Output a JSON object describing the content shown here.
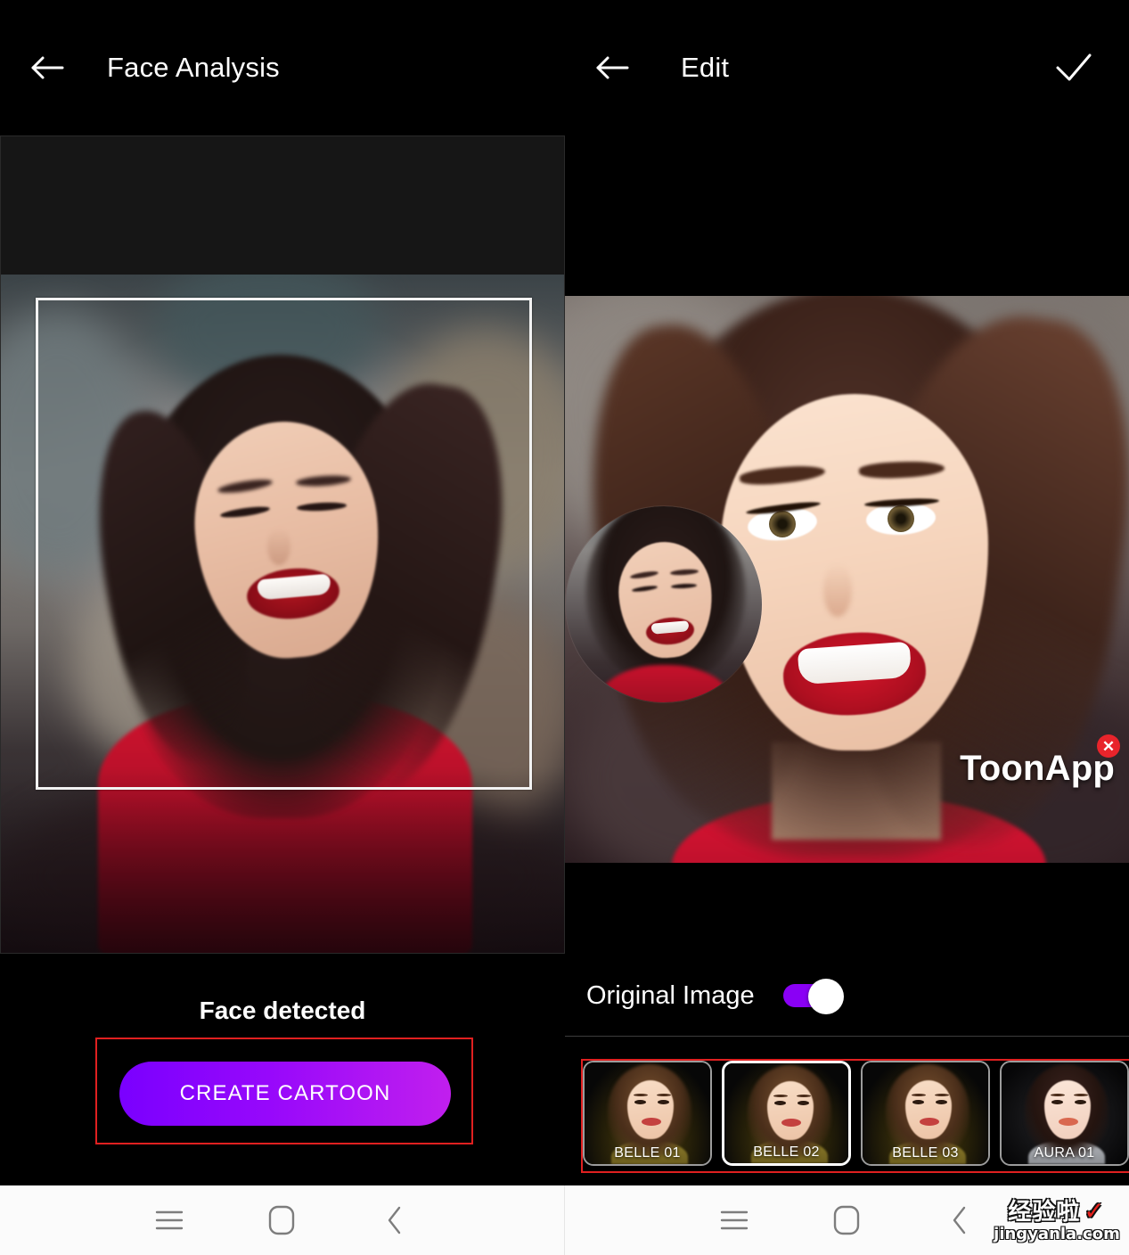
{
  "left_panel": {
    "header": {
      "back_icon": "arrow-left-icon",
      "title": "Face Analysis"
    },
    "stage": {
      "detection_frame": "face-detection-frame",
      "photo_alt": "original-portrait-photo"
    },
    "footer": {
      "status_text": "Face detected",
      "create_button_label": "CREATE CARTOON",
      "annotation_color": "#e02020"
    }
  },
  "right_panel": {
    "header": {
      "back_icon": "arrow-left-icon",
      "title": "Edit",
      "confirm_icon": "check-icon"
    },
    "stage": {
      "cartoon_alt": "cartoon-result-image",
      "original_bubble_alt": "original-image-preview",
      "watermark_text": "ToonApp",
      "watermark_close_label": "✕"
    },
    "controls": {
      "toggle_label": "Original Image",
      "toggle_on": true,
      "toggle_color": "#8a00f5",
      "annotation_color": "#e02020"
    },
    "styles": [
      {
        "label": "BELLE 01",
        "selected": false,
        "theme": "belle"
      },
      {
        "label": "BELLE 02",
        "selected": true,
        "theme": "belle"
      },
      {
        "label": "BELLE 03",
        "selected": false,
        "theme": "belle"
      },
      {
        "label": "AURA 01",
        "selected": false,
        "theme": "aura"
      }
    ]
  },
  "system_nav": {
    "recents_icon": "menu-icon",
    "home_icon": "home-square-icon",
    "back_icon": "chevron-left-icon"
  },
  "site_watermark": {
    "brand_cn": "经验啦",
    "tick": "✓",
    "url": "jingyanla.com"
  },
  "accent": {
    "button_gradient_start": "#7a00ff",
    "button_gradient_end": "#c11fee",
    "annotation_red": "#e02020"
  }
}
